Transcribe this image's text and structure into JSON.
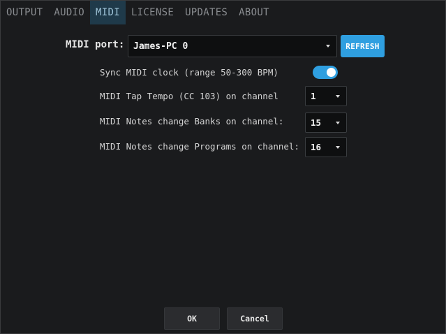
{
  "tabs": [
    {
      "label": "OUTPUT",
      "active": false
    },
    {
      "label": "AUDIO",
      "active": false
    },
    {
      "label": "MIDI",
      "active": true
    },
    {
      "label": "LICENSE",
      "active": false
    },
    {
      "label": "UPDATES",
      "active": false
    },
    {
      "label": "ABOUT",
      "active": false
    }
  ],
  "midi": {
    "port_label": "MIDI port:",
    "port_value": "James-PC 0",
    "refresh_label": "REFRESH",
    "sync_clock_label": "Sync MIDI clock (range 50-300 BPM)",
    "sync_clock_enabled": true,
    "tap_tempo_label": "MIDI Tap Tempo (CC 103) on channel",
    "tap_tempo_channel": "1",
    "banks_label": "MIDI Notes change Banks on channel:",
    "banks_channel": "15",
    "programs_label": "MIDI Notes change Programs on channel:",
    "programs_channel": "16"
  },
  "footer": {
    "ok_label": "OK",
    "cancel_label": "Cancel"
  },
  "colors": {
    "accent": "#2f9fe0",
    "background": "#1a1b1d",
    "active_tab": "#1f3a4a"
  }
}
